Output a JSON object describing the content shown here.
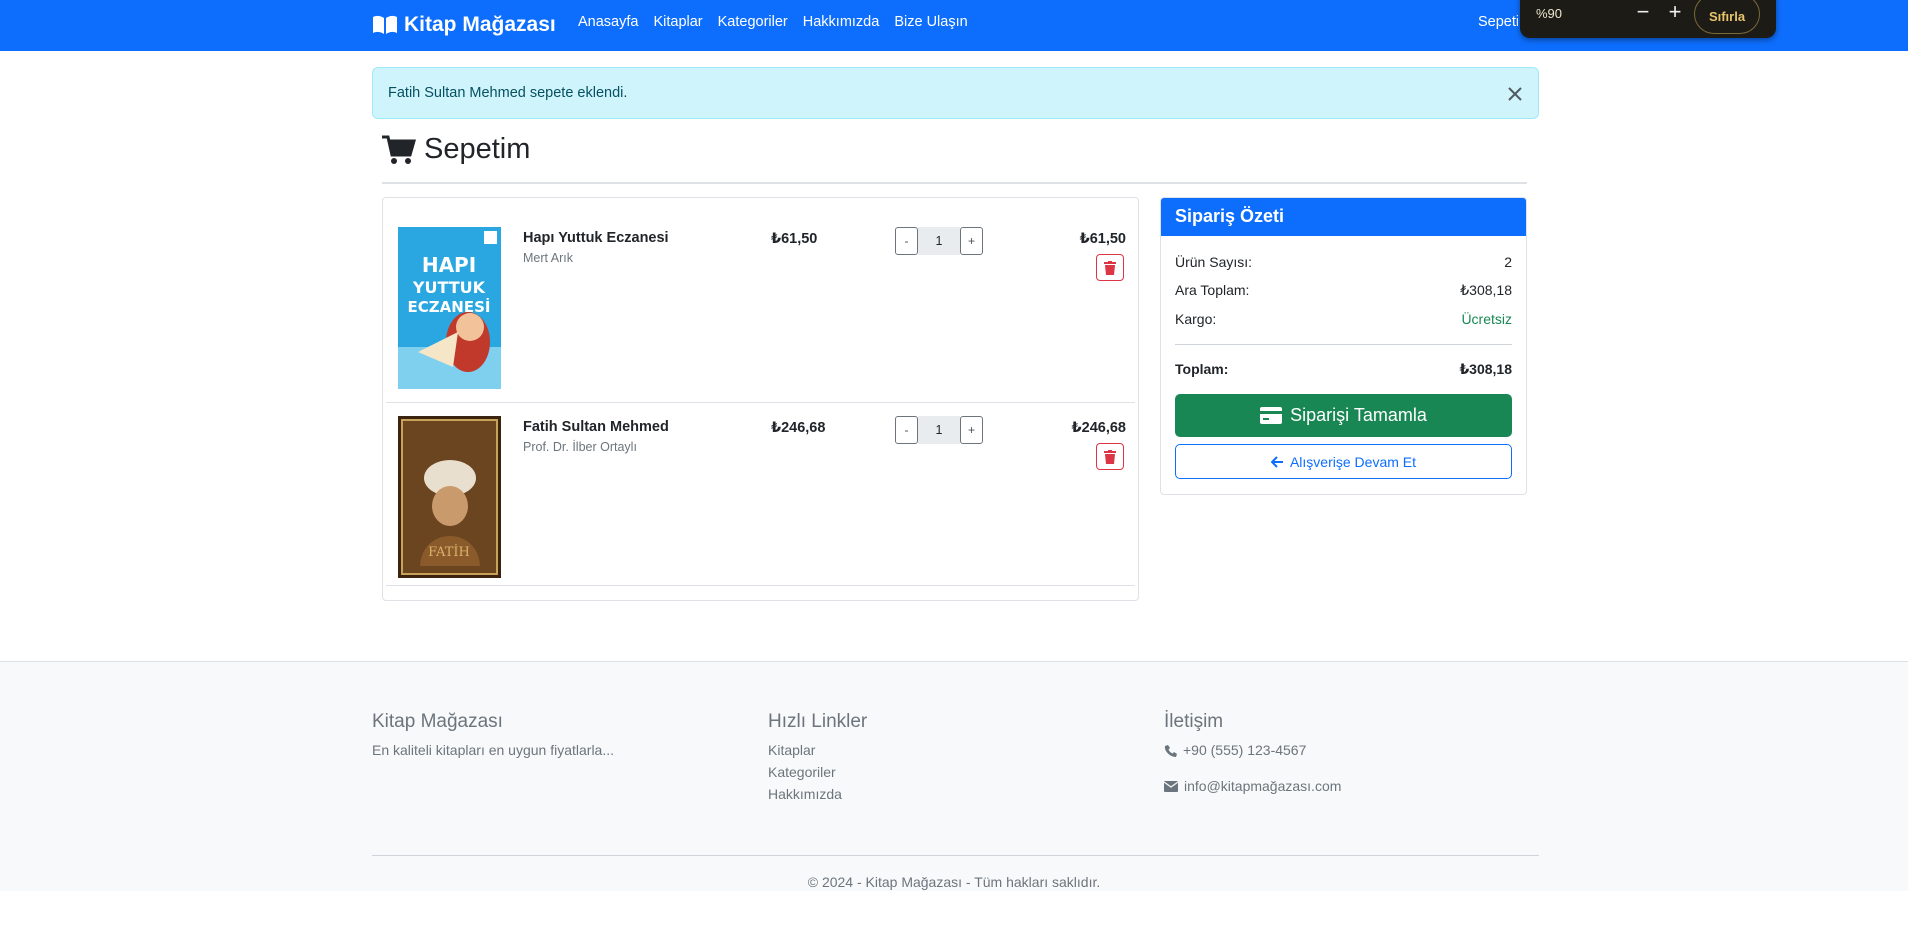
{
  "nav": {
    "brand": "Kitap Mağazası",
    "links": [
      "Anasayfa",
      "Kitaplar",
      "Kategoriler",
      "Hakkımızda",
      "Bize Ulaşın"
    ],
    "cart_label": "Sepetim"
  },
  "zoom": {
    "level": "%90",
    "minus": "−",
    "plus": "+",
    "reset": "Sıfırla"
  },
  "alert": {
    "message": "Fatih Sultan Mehmed sepete eklendi."
  },
  "page": {
    "title": "Sepetim"
  },
  "cart": {
    "items": [
      {
        "title": "Hapı Yuttuk Eczanesi",
        "author": "Mert Arık",
        "price": "₺61,50",
        "qty": "1",
        "line_total": "₺61,50",
        "cover_color": "#2aa7e0"
      },
      {
        "title": "Fatih Sultan Mehmed",
        "author": "Prof. Dr. İlber Ortaylı",
        "price": "₺246,68",
        "qty": "1",
        "line_total": "₺246,68",
        "cover_color": "#5a3a1a"
      }
    ],
    "minus": "-",
    "plus": "+"
  },
  "summary": {
    "title": "Sipariş Özeti",
    "item_count_label": "Ürün Sayısı:",
    "item_count": "2",
    "subtotal_label": "Ara Toplam:",
    "subtotal": "₺308,18",
    "shipping_label": "Kargo:",
    "shipping": "Ücretsiz",
    "total_label": "Toplam:",
    "total": "₺308,18",
    "complete_button": "Siparişi Tamamla",
    "continue_button": "Alışverişe Devam Et"
  },
  "footer": {
    "about_title": "Kitap Mağazası",
    "about_text": "En kaliteli kitapları en uygun fiyatlarla...",
    "links_title": "Hızlı Linkler",
    "links": [
      "Kitaplar",
      "Kategoriler",
      "Hakkımızda"
    ],
    "contact_title": "İletişim",
    "phone": "+90 (555) 123-4567",
    "email": "info@kitapmağazası.com",
    "copyright": "© 2024 - Kitap Mağazası - Tüm hakları saklıdır."
  },
  "colors": {
    "primary": "#0d6efd",
    "success": "#198754",
    "danger": "#dc3545",
    "alert_bg": "#cff4fc"
  }
}
